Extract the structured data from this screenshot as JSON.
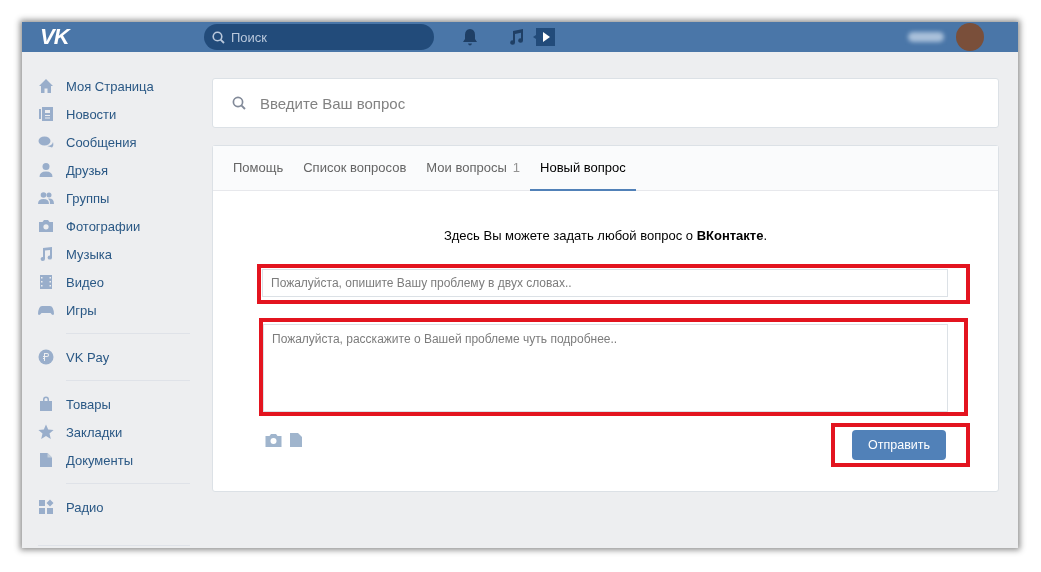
{
  "header": {
    "logo": "VK",
    "search": {
      "placeholder": "Поиск"
    }
  },
  "sidebar": {
    "groups": [
      [
        {
          "label": "Моя Страница"
        },
        {
          "label": "Новости"
        },
        {
          "label": "Сообщения"
        },
        {
          "label": "Друзья"
        },
        {
          "label": "Группы"
        },
        {
          "label": "Фотографии"
        },
        {
          "label": "Музыка"
        },
        {
          "label": "Видео"
        },
        {
          "label": "Игры"
        }
      ],
      [
        {
          "label": "VK Pay"
        }
      ],
      [
        {
          "label": "Товары"
        },
        {
          "label": "Закладки"
        },
        {
          "label": "Документы"
        }
      ],
      [
        {
          "label": "Радио"
        }
      ]
    ]
  },
  "question_search": {
    "placeholder": "Введите Ваш вопрос"
  },
  "tabs": [
    {
      "label": "Помощь",
      "selected": false
    },
    {
      "label": "Список вопросов",
      "selected": false
    },
    {
      "label": "Мои вопросы",
      "count": "1",
      "selected": false
    },
    {
      "label": "Новый вопрос",
      "selected": true
    }
  ],
  "intro": "Здесь Вы можете задать любой вопрос о **ВКонтакте**.",
  "title_field": {
    "placeholder": "Пожалуйста, опишите Вашу проблему в двух словах..",
    "highlighted": true
  },
  "details_field": {
    "placeholder": "Пожалуйста, расскажите о Вашей проблеме чуть подробнее..",
    "highlighted": true
  },
  "submit": {
    "label": "Отправить",
    "highlighted": true
  }
}
